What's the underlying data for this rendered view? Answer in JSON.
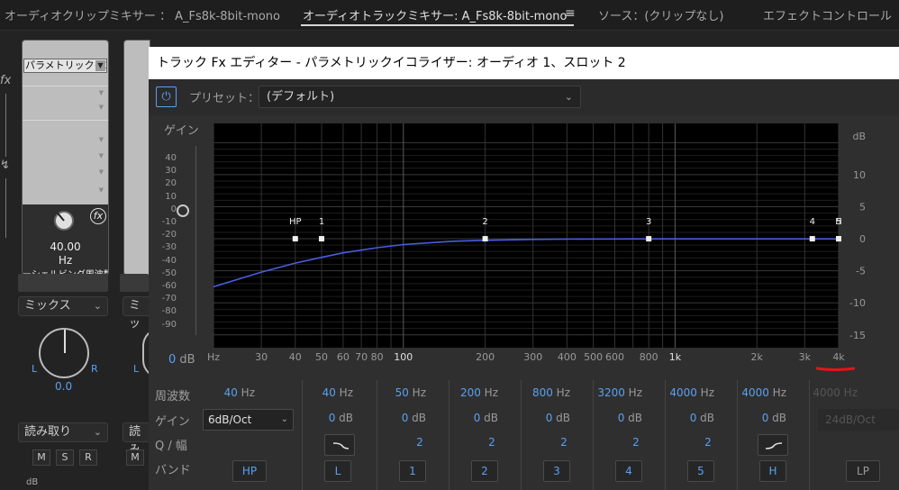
{
  "tabs": [
    {
      "label": "オーディオクリップミキサー ： A_Fs8k-8bit-mono"
    },
    {
      "label": "オーディオトラックミキサー: A_Fs8k-8bit-mono"
    },
    {
      "label": "ソース：(クリップなし)"
    },
    {
      "label": "エフェクトコントロール"
    }
  ],
  "tab_menu": "≡",
  "mixer": {
    "fx_glyph": "fx",
    "send_glyph": "↯",
    "fx_slot": "パラメトリックイコ",
    "knob_value": "40.00",
    "knob_unit": "Hz",
    "knob_name": "ーシェルビング周波数",
    "fx_badge": "fx",
    "mix_label": "ミックス",
    "mix_label2": "ミッ",
    "pan_left": "L",
    "pan_right": "R",
    "pan_value": "0.0",
    "read_label": "読み取り",
    "read_label2": "読み",
    "m": "M",
    "s": "S",
    "r": "R",
    "db": "dB"
  },
  "dialog": {
    "title": "トラック Fx エディター - パラメトリックイコライザー: オーディオ 1、スロット 2",
    "power_icon": "⏻",
    "preset_label": "プリセット：",
    "preset_value": "(デフォルト)",
    "gain_title": "ゲイン",
    "gain_readout_value": "0",
    "gain_readout_unit": "dB",
    "gain_scale": [
      "40",
      "30",
      "20",
      "10",
      "0",
      "-10",
      "-20",
      "-30",
      "-40",
      "-50",
      "-60",
      "-70",
      "-80",
      "-90"
    ]
  },
  "chart_data": {
    "type": "line",
    "title": "",
    "xscale": "log",
    "xlim": [
      20,
      4000
    ],
    "ylim": [
      -17,
      18
    ],
    "ylabel": "dB",
    "x_tick_labels": [
      "Hz",
      "30",
      "40",
      "50",
      "60",
      "70",
      "80",
      "100",
      "200",
      "300",
      "400",
      "500",
      "600",
      "800",
      "1k",
      "2k",
      "3k",
      "4k"
    ],
    "y_tick_labels": [
      "dB",
      "10",
      "5",
      "0",
      "-5",
      "-10",
      "-15"
    ],
    "series": [
      {
        "x": [
          20,
          30,
          40,
          50,
          60,
          80,
          100,
          150,
          200,
          300,
          400,
          800,
          1000,
          2000,
          3000,
          4000
        ],
        "y": [
          -7.5,
          -5.2,
          -3.8,
          -2.9,
          -2.2,
          -1.4,
          -0.9,
          -0.4,
          -0.25,
          -0.1,
          -0.05,
          -0.02,
          -0.02,
          -0.02,
          -0.02,
          -0.02
        ]
      }
    ],
    "band_nodes": [
      {
        "label": "HP",
        "freq": 40,
        "gain": 0
      },
      {
        "label": "1",
        "freq": 50,
        "gain": 0
      },
      {
        "label": "2",
        "freq": 200,
        "gain": 0
      },
      {
        "label": "3",
        "freq": 800,
        "gain": 0
      },
      {
        "label": "4",
        "freq": 3200,
        "gain": 0
      },
      {
        "label": "5",
        "freq": 4000,
        "gain": 0
      },
      {
        "label": "H",
        "freq": 4000,
        "gain": 0
      }
    ],
    "line_color": "#4a5de0",
    "grid": true
  },
  "bands": {
    "row_labels": [
      "周波数",
      "ゲイン",
      "Q / 幅",
      "バンド"
    ],
    "slope": "6dB/Oct",
    "lp_slope": "24dB/Oct",
    "freq": [
      {
        "n": "40",
        "u": "Hz"
      },
      {
        "n": "40",
        "u": "Hz"
      },
      {
        "n": "50",
        "u": "Hz"
      },
      {
        "n": "200",
        "u": "Hz"
      },
      {
        "n": "800",
        "u": "Hz"
      },
      {
        "n": "3200",
        "u": "Hz"
      },
      {
        "n": "4000",
        "u": "Hz"
      },
      {
        "n": "4000",
        "u": "Hz"
      },
      {
        "n": "4000",
        "u": "Hz"
      }
    ],
    "gain": [
      {
        "n": "0",
        "u": "dB"
      },
      {
        "n": "0",
        "u": "dB"
      },
      {
        "n": "0",
        "u": "dB"
      },
      {
        "n": "0",
        "u": "dB"
      },
      {
        "n": "0",
        "u": "dB"
      },
      {
        "n": "0",
        "u": "dB"
      },
      {
        "n": "0",
        "u": "dB"
      }
    ],
    "q": [
      "2",
      "2",
      "2",
      "2",
      "2"
    ],
    "band_buttons": [
      "HP",
      "L",
      "1",
      "2",
      "3",
      "4",
      "5",
      "H",
      "LP"
    ]
  }
}
